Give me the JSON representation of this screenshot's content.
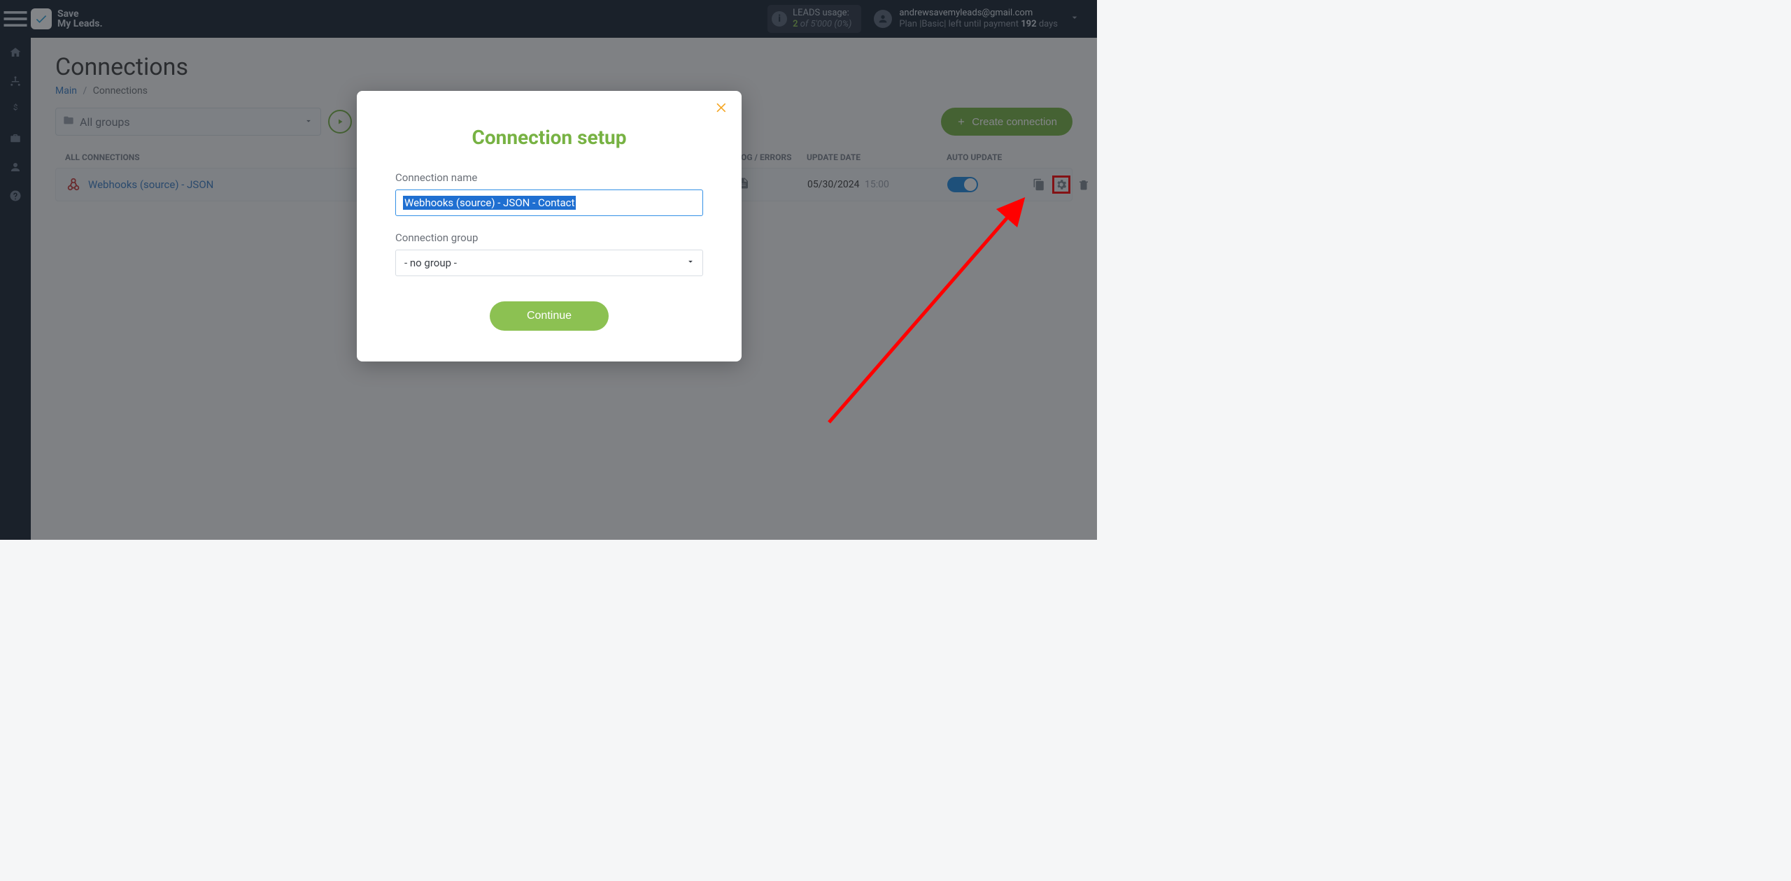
{
  "brand": {
    "line1": "Save",
    "line2": "My Leads."
  },
  "usage": {
    "label": "LEADS usage:",
    "current": "2",
    "of_word": "of",
    "max": "5'000",
    "percent": "(0%)"
  },
  "account": {
    "email": "andrewsavemyleads@gmail.com",
    "plan_prefix": "Plan |Basic| left until payment ",
    "days": "192",
    "days_suffix": " days"
  },
  "page": {
    "title": "Connections",
    "breadcrumb_main": "Main",
    "breadcrumb_current": "Connections"
  },
  "toolbar": {
    "groups_label": "All groups",
    "create_label": "Create connection"
  },
  "columns": {
    "name": "ALL CONNECTIONS",
    "log": "LOG / ERRORS",
    "date": "UPDATE DATE",
    "auto": "AUTO UPDATE"
  },
  "rows": [
    {
      "name": "Webhooks (source) - JSON",
      "date": "05/30/2024",
      "time": "15:00"
    }
  ],
  "modal": {
    "title": "Connection setup",
    "name_label": "Connection name",
    "name_value": "Webhooks (source) - JSON - Contact",
    "group_label": "Connection group",
    "group_value": "- no group -",
    "continue": "Continue"
  }
}
